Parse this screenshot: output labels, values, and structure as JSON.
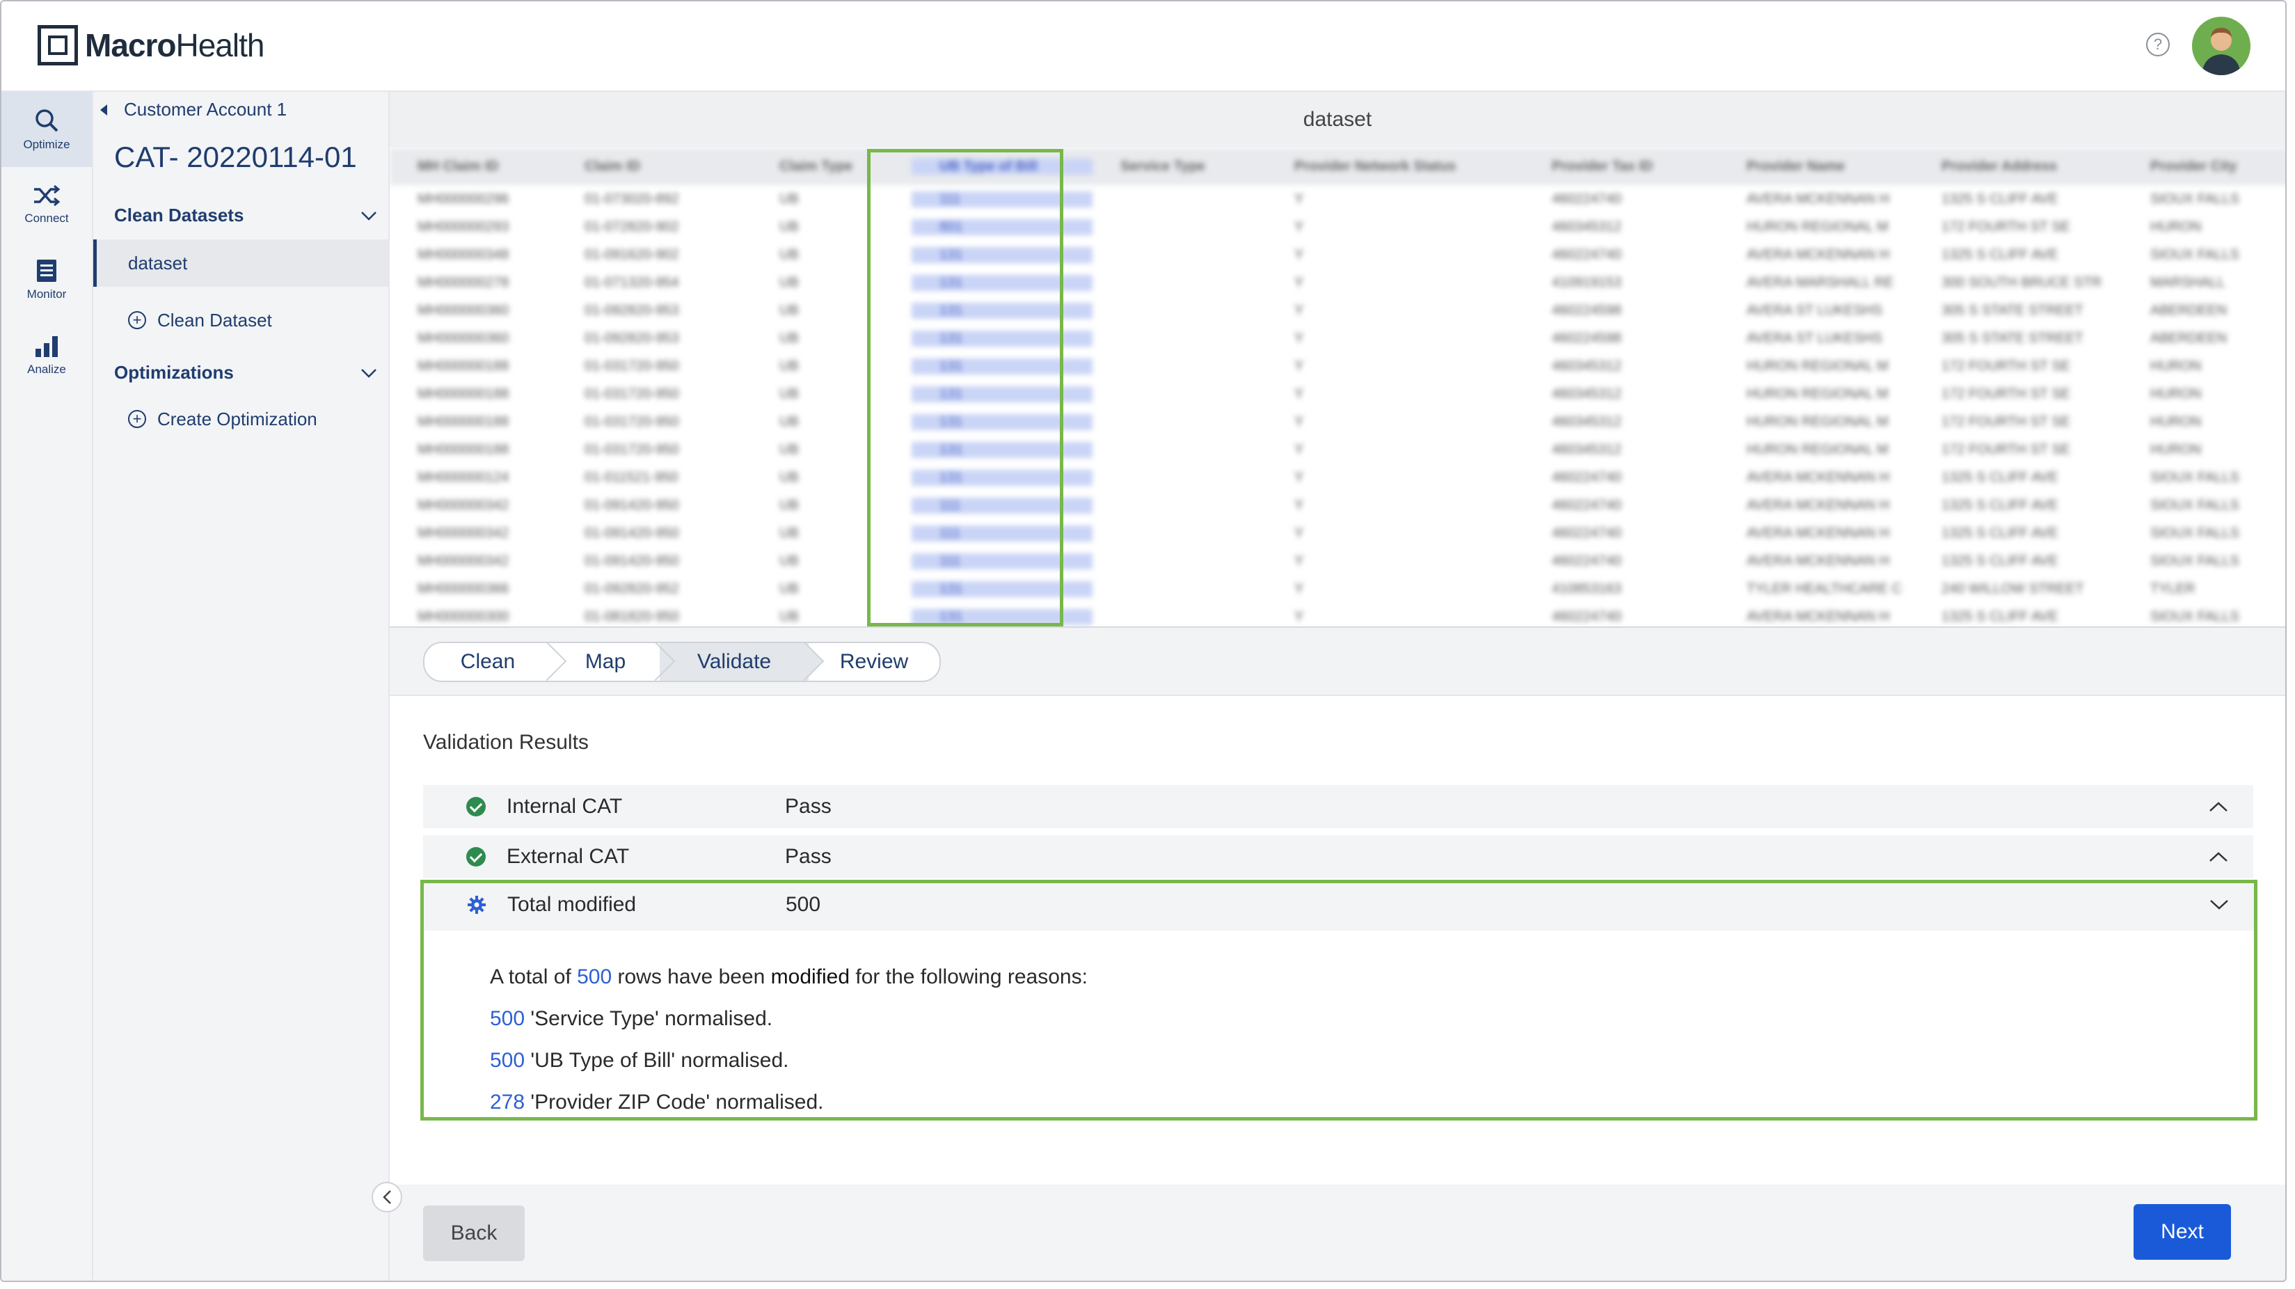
{
  "app": {
    "logo_bold": "Macro",
    "logo_light": "Health"
  },
  "header": {
    "help_icon": "?",
    "avatar_icon": "user-avatar"
  },
  "rail": [
    {
      "label": "Optimize",
      "icon": "search-icon",
      "active": true
    },
    {
      "label": "Connect",
      "icon": "shuffle-icon",
      "active": false
    },
    {
      "label": "Monitor",
      "icon": "document-icon",
      "active": false
    },
    {
      "label": "Analize",
      "icon": "bar-chart-icon",
      "active": false
    }
  ],
  "side": {
    "breadcrumb": "Customer Account 1",
    "title": "CAT- 20220114-01",
    "clean_datasets": "Clean Datasets",
    "dataset_item": "dataset",
    "clean_dataset_action": "Clean Dataset",
    "optimizations": "Optimizations",
    "create_optimization_action": "Create Optimization"
  },
  "main": {
    "dataset_label": "dataset",
    "steps": [
      "Clean",
      "Map",
      "Validate",
      "Review"
    ],
    "active_step": "Validate",
    "validation_title": "Validation Results",
    "results": [
      {
        "name": "Internal CAT",
        "value": "Pass",
        "icon": "check-circle-icon"
      },
      {
        "name": "External CAT",
        "value": "Pass",
        "icon": "check-circle-icon"
      },
      {
        "name": "Total modified",
        "value": "500",
        "icon": "gear-icon"
      }
    ],
    "detail": {
      "prefix": "A total of",
      "count": "500",
      "mid": "rows have been",
      "bold": "modified",
      "suffix": "for the following reasons:",
      "reasons": [
        {
          "count": "500",
          "text": "'Service Type' normalised."
        },
        {
          "count": "500",
          "text": "'UB Type of Bill' normalised."
        },
        {
          "count": "278",
          "text": "'Provider ZIP Code' normalised."
        }
      ]
    },
    "back_label": "Back",
    "next_label": "Next"
  },
  "table": {
    "columns": [
      "MH Claim ID",
      "Claim ID",
      "Claim Type",
      "UB Type of Bill",
      "Service Type",
      "Provider Network Status",
      "Provider Tax ID",
      "Provider Name",
      "Provider Address",
      "Provider City"
    ],
    "highlight_column": "UB Type of Bill",
    "rows": [
      [
        "MH000000296",
        "01-073020-892",
        "UB",
        "111",
        "",
        "Y",
        "460224740",
        "AVERA MCKENNAN H",
        "1325 S CLIFF AVE",
        "SIOUX FALLS"
      ],
      [
        "MH000000293",
        "01-072820-902",
        "UB",
        "801",
        "",
        "Y",
        "460345312",
        "HURON REGIONAL M",
        "172 FOURTH ST SE",
        "HURON"
      ],
      [
        "MH000000348",
        "01-091620-902",
        "UB",
        "131",
        "",
        "Y",
        "460224740",
        "AVERA MCKENNAN H",
        "1325 S CLIFF AVE",
        "SIOUX FALLS"
      ],
      [
        "MH000000278",
        "01-071320-954",
        "UB",
        "131",
        "",
        "Y",
        "410919153",
        "AVERA MARSHALL RE",
        "300 SOUTH BRUCE STR",
        "MARSHALL"
      ],
      [
        "MH000000360",
        "01-092820-953",
        "UB",
        "131",
        "",
        "Y",
        "460224598",
        "AVERA ST LUKESHS",
        "305 S STATE STREET",
        "ABERDEEN"
      ],
      [
        "MH000000360",
        "01-092820-953",
        "UB",
        "131",
        "",
        "Y",
        "460224598",
        "AVERA ST LUKESHS",
        "305 S STATE STREET",
        "ABERDEEN"
      ],
      [
        "MH000000188",
        "01-031720-950",
        "UB",
        "131",
        "",
        "Y",
        "460345312",
        "HURON REGIONAL M",
        "172 FOURTH ST SE",
        "HURON"
      ],
      [
        "MH000000188",
        "01-031720-950",
        "UB",
        "131",
        "",
        "Y",
        "460345312",
        "HURON REGIONAL M",
        "172 FOURTH ST SE",
        "HURON"
      ],
      [
        "MH000000188",
        "01-031720-950",
        "UB",
        "131",
        "",
        "Y",
        "460345312",
        "HURON REGIONAL M",
        "172 FOURTH ST SE",
        "HURON"
      ],
      [
        "MH000000188",
        "01-031720-950",
        "UB",
        "131",
        "",
        "Y",
        "460345312",
        "HURON REGIONAL M",
        "172 FOURTH ST SE",
        "HURON"
      ],
      [
        "MH000000124",
        "01-011521-950",
        "UB",
        "131",
        "",
        "Y",
        "460224740",
        "AVERA MCKENNAN H",
        "1325 S CLIFF AVE",
        "SIOUX FALLS"
      ],
      [
        "MH000000342",
        "01-091420-950",
        "UB",
        "111",
        "",
        "Y",
        "460224740",
        "AVERA MCKENNAN H",
        "1325 S CLIFF AVE",
        "SIOUX FALLS"
      ],
      [
        "MH000000342",
        "01-091420-950",
        "UB",
        "111",
        "",
        "Y",
        "460224740",
        "AVERA MCKENNAN H",
        "1325 S CLIFF AVE",
        "SIOUX FALLS"
      ],
      [
        "MH000000342",
        "01-091420-950",
        "UB",
        "111",
        "",
        "Y",
        "460224740",
        "AVERA MCKENNAN H",
        "1325 S CLIFF AVE",
        "SIOUX FALLS"
      ],
      [
        "MH000000366",
        "01-092820-952",
        "UB",
        "131",
        "",
        "Y",
        "410853163",
        "TYLER HEALTHCARE C",
        "240 WILLOW STREET",
        "TYLER"
      ],
      [
        "MH000000300",
        "01-081820-950",
        "UB",
        "131",
        "",
        "Y",
        "460224740",
        "AVERA MCKENNAN H",
        "1325 S CLIFF AVE",
        "SIOUX FALLS"
      ]
    ]
  },
  "colors": {
    "accent": "#1a5ad8",
    "highlight_border": "#78b84a",
    "pass": "#2e8b4e",
    "number": "#2d5fd6"
  }
}
